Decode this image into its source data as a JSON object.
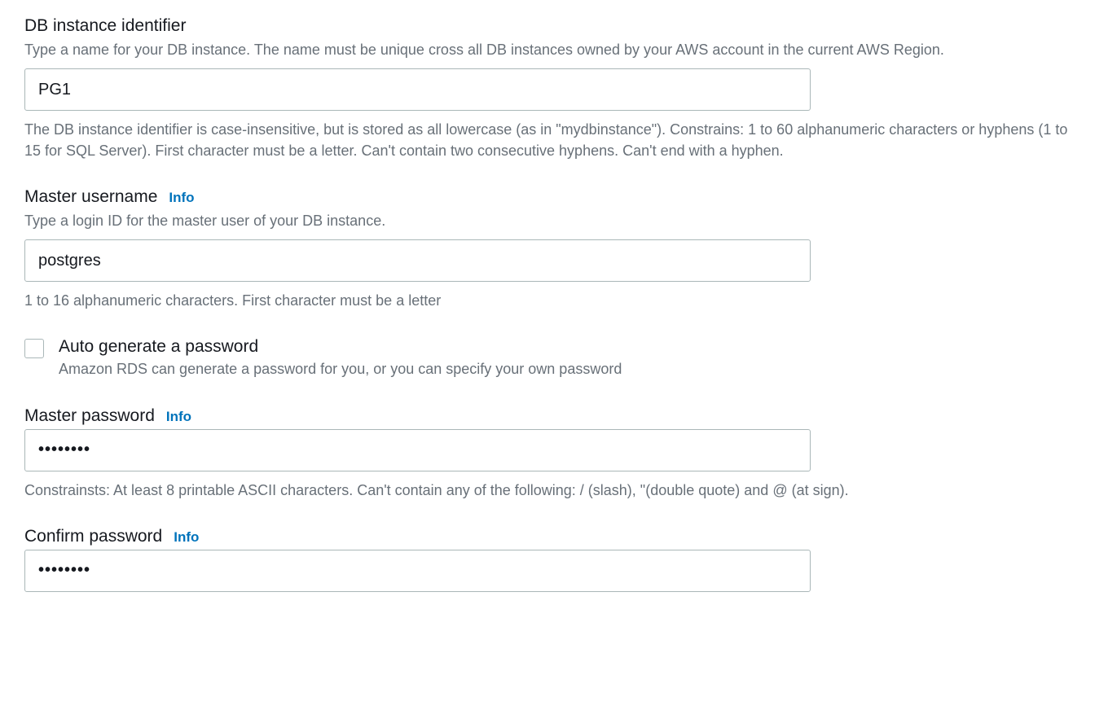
{
  "db_identifier": {
    "label": "DB instance identifier",
    "description": "Type a name for your DB instance. The name must be unique cross all DB instances owned by your AWS account in the current AWS Region.",
    "value": "PG1",
    "hint": "The DB instance identifier is case-insensitive, but is stored as all lowercase (as in \"mydbinstance\"). Constrains: 1 to 60 alphanumeric characters or hyphens (1 to 15 for SQL Server). First character must be a letter. Can't contain two consecutive hyphens. Can't end with a hyphen."
  },
  "master_username": {
    "label": "Master username",
    "info": "Info",
    "description": "Type a login ID for the master user of your DB instance.",
    "value": "postgres",
    "hint": "1 to 16 alphanumeric characters. First character must be a letter"
  },
  "auto_generate": {
    "label": "Auto generate a password",
    "description": "Amazon RDS can generate a password for you, or you can specify your own password"
  },
  "master_password": {
    "label": "Master password",
    "info": "Info",
    "value": "••••••••",
    "hint": "Constrainsts: At least 8 printable ASCII characters. Can't contain any of the following: / (slash), \"(double quote) and @ (at sign)."
  },
  "confirm_password": {
    "label": "Confirm password",
    "info": "Info",
    "value": "••••••••"
  }
}
